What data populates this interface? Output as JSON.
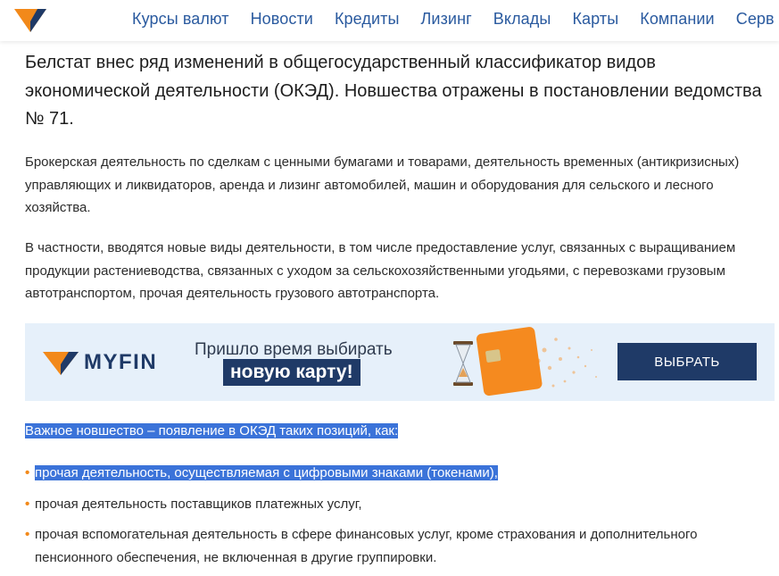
{
  "header": {
    "nav": [
      "Курсы валют",
      "Новости",
      "Кредиты",
      "Лизинг",
      "Вклады",
      "Карты",
      "Компании",
      "Серв"
    ],
    "brand_colors": {
      "orange": "#f2891a",
      "navy": "#1f3a67",
      "link": "#2a5a9f"
    }
  },
  "article": {
    "lead": "Белстат внес ряд изменений в общегосударственный классификатор видов экономической деятельности (ОКЭД). Новшества отражены в постановлении ведомства № 71.",
    "p1": "Брокерская деятельность по сделкам с ценными бумагами и товарами, деятельность временных (антикризисных) управляющих и ликвидаторов, аренда и лизинг автомобилей, машин и оборудования для сельского и лесного хозяйства.",
    "p2": "В частности, вводятся новые виды деятельности, в том числе предоставление услуг, связанных с выращиванием продукции растениеводства, связанных с уходом за сельскохозяйственными угодьями, с перевозками грузовым автотранспортом, прочая деятельность грузового автотранспорта.",
    "intro": "Важное новшество – появление в ОКЭД таких позиций, как:",
    "items": [
      "прочая деятельность, осуществляемая с цифровыми знаками (токенами),",
      "прочая деятельность поставщиков платежных услуг,",
      "прочая вспомогательная деятельность в сфере финансовых услуг, кроме страхования и дополнительного пенсионного обеспечения, не включенная в другие группировки."
    ],
    "bullet": "•"
  },
  "banner": {
    "brand": "MYFIN",
    "line1": "Пришло время выбирать",
    "line2": "новую карту!",
    "button": "ВЫБРАТЬ"
  }
}
